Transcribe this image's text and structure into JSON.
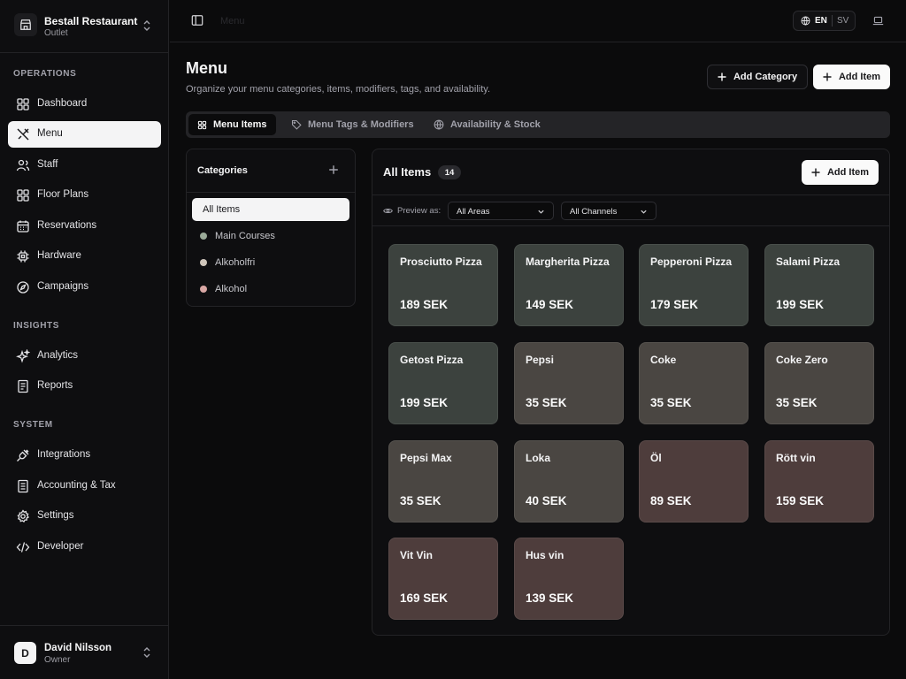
{
  "org": {
    "name": "Bestall Restaurant",
    "subtitle": "Outlet"
  },
  "sidebar": {
    "sections": [
      {
        "label": "OPERATIONS"
      },
      {
        "label": "INSIGHTS"
      },
      {
        "label": "SYSTEM"
      }
    ],
    "items": [
      {
        "label": "Dashboard",
        "icon": "dashboard-icon"
      },
      {
        "label": "Menu",
        "icon": "utensils-icon",
        "active": true
      },
      {
        "label": "Staff",
        "icon": "users-icon"
      },
      {
        "label": "Floor Plans",
        "icon": "floor-plans-icon"
      },
      {
        "label": "Reservations",
        "icon": "calendar-icon"
      },
      {
        "label": "Hardware",
        "icon": "chip-icon"
      },
      {
        "label": "Campaigns",
        "icon": "compass-icon"
      },
      {
        "label": "Analytics",
        "icon": "sparkles-icon"
      },
      {
        "label": "Reports",
        "icon": "report-icon"
      },
      {
        "label": "Integrations",
        "icon": "plug-icon"
      },
      {
        "label": "Accounting & Tax",
        "icon": "receipt-icon"
      },
      {
        "label": "Settings",
        "icon": "gear-icon"
      },
      {
        "label": "Developer",
        "icon": "code-icon"
      }
    ]
  },
  "user": {
    "initial": "D",
    "name": "David Nilsson",
    "role": "Owner"
  },
  "topbar": {
    "breadcrumb": "Menu",
    "lang_active": "EN",
    "lang_other": "SV"
  },
  "header": {
    "title": "Menu",
    "subtitle": "Organize your menu categories, items, modifiers, tags, and availability.",
    "add_category_label": "Add Category",
    "add_item_label": "Add Item"
  },
  "tabs": [
    {
      "label": "Menu Items",
      "active": true
    },
    {
      "label": "Menu Tags & Modifiers"
    },
    {
      "label": "Availability & Stock"
    }
  ],
  "categories": {
    "title": "Categories",
    "items": [
      {
        "label": "All Items",
        "active": true
      },
      {
        "label": "Main Courses",
        "color": "#9aaa98"
      },
      {
        "label": "Alkoholfri",
        "color": "#cfc6bb"
      },
      {
        "label": "Alkohol",
        "color": "#d9a7a4"
      }
    ]
  },
  "items_panel": {
    "title": "All Items",
    "count": "14",
    "add_item_label": "Add Item",
    "preview_label": "Preview as:",
    "area_select": "All Areas",
    "channel_select": "All Channels"
  },
  "menu_items": [
    {
      "name": "Prosciutto Pizza",
      "price": "189 SEK",
      "color": "#3c423e"
    },
    {
      "name": "Margherita Pizza",
      "price": "149 SEK",
      "color": "#3c423e"
    },
    {
      "name": "Pepperoni Pizza",
      "price": "179 SEK",
      "color": "#3c423e"
    },
    {
      "name": "Salami Pizza",
      "price": "199 SEK",
      "color": "#3c423e"
    },
    {
      "name": "Getost Pizza",
      "price": "199 SEK",
      "color": "#3c423e"
    },
    {
      "name": "Pepsi",
      "price": "35 SEK",
      "color": "#4a4642"
    },
    {
      "name": "Coke",
      "price": "35 SEK",
      "color": "#4a4642"
    },
    {
      "name": "Coke Zero",
      "price": "35 SEK",
      "color": "#4a4642"
    },
    {
      "name": "Pepsi Max",
      "price": "35 SEK",
      "color": "#4a4642"
    },
    {
      "name": "Loka",
      "price": "40 SEK",
      "color": "#4a4642"
    },
    {
      "name": "Öl",
      "price": "89 SEK",
      "color": "#4e3d3c"
    },
    {
      "name": "Rött vin",
      "price": "159 SEK",
      "color": "#4e3d3c"
    },
    {
      "name": "Vit Vin",
      "price": "169 SEK",
      "color": "#4e3d3c"
    },
    {
      "name": "Hus vin",
      "price": "139 SEK",
      "color": "#4e3d3c"
    }
  ]
}
